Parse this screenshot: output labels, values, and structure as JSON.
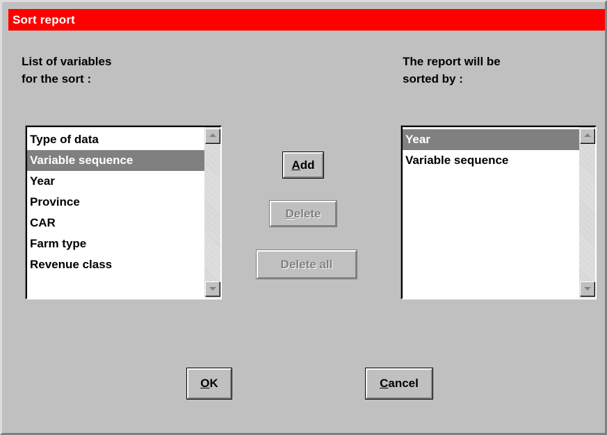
{
  "window": {
    "title": "Sort report"
  },
  "left": {
    "label_line1": "List of variables",
    "label_line2": "for the sort :",
    "items": [
      "Type of data",
      "Variable sequence",
      "Year",
      "Province",
      "CAR",
      "Farm type",
      "Revenue class"
    ],
    "selected_index": 1
  },
  "right": {
    "label_line1": "The report will be",
    "label_line2": "sorted by :",
    "items": [
      "Year",
      "Variable sequence"
    ],
    "selected_index": 0
  },
  "buttons": {
    "add": {
      "mnemonic": "A",
      "rest": "dd",
      "enabled": true
    },
    "delete": {
      "mnemonic": "D",
      "rest": "elete",
      "enabled": false
    },
    "delete_all": {
      "mnemonic": "",
      "rest": "Delete all",
      "enabled": false
    },
    "ok": {
      "mnemonic": "O",
      "rest": "K",
      "enabled": true
    },
    "cancel": {
      "mnemonic": "C",
      "rest": "ancel",
      "enabled": true
    }
  },
  "icons": {
    "scroll_up": "scroll-up-arrow-icon",
    "scroll_down": "scroll-down-arrow-icon"
  },
  "colors": {
    "title_bar": "#ff0000",
    "title_text": "#ffffff",
    "dialog_bg": "#c0c0c0",
    "selection_bg": "#808080"
  }
}
